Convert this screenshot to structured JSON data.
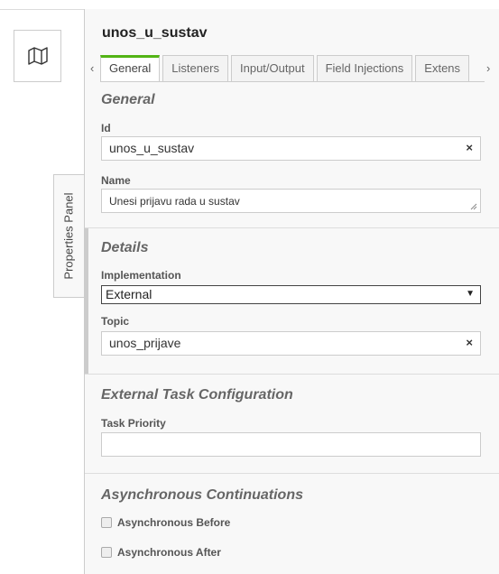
{
  "sidebar_toggle_label": "Properties Panel",
  "panel": {
    "element_title": "unos_u_sustav",
    "tab_prev": "‹",
    "tab_next": "›",
    "tabs": [
      "General",
      "Listeners",
      "Input/Output",
      "Field Injections",
      "Extens"
    ],
    "active_tab": "General",
    "general": {
      "title": "General",
      "id_label": "Id",
      "id_value": "unos_u_sustav",
      "name_label": "Name",
      "name_value": "Unesi prijavu rada u sustav",
      "clear": "×"
    },
    "details": {
      "title": "Details",
      "implementation_label": "Implementation",
      "implementation_value": "External",
      "select_arrow": "▼",
      "topic_label": "Topic",
      "topic_value": "unos_prijave",
      "clear": "×"
    },
    "external_task": {
      "title": "External Task Configuration",
      "priority_label": "Task Priority",
      "priority_value": ""
    },
    "async": {
      "title": "Asynchronous Continuations",
      "before_label": "Asynchronous Before",
      "after_label": "Asynchronous After"
    }
  },
  "colors": {
    "active_tab_accent": "#52b415",
    "panel_bg": "#f8f8f8"
  },
  "icons": {
    "map_button": "map-icon"
  }
}
